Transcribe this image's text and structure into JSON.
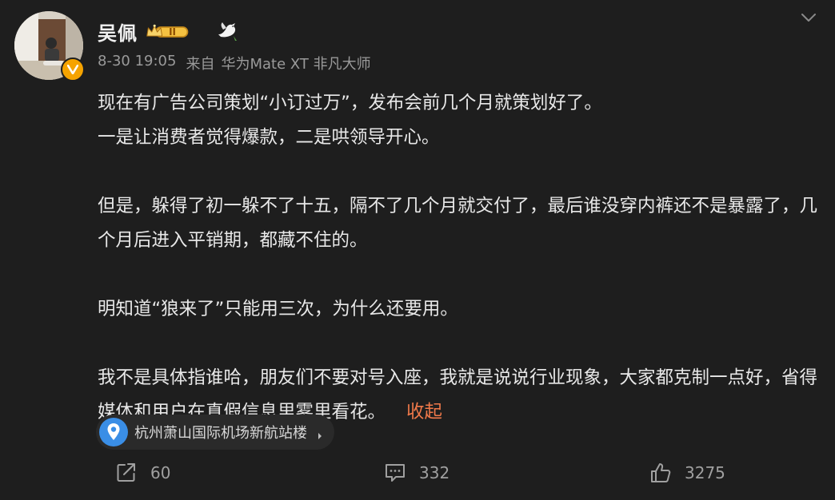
{
  "user": {
    "name": "吴佩",
    "vip_level": "II"
  },
  "meta": {
    "time": "8-30 19:05",
    "source_prefix": "来自",
    "device": "华为Mate XT 非凡大师"
  },
  "content": {
    "paragraphs": [
      [
        "现在有广告公司策划“小订过万”，发布会前几个月就策划好了。",
        "一是让消费者觉得爆款，二是哄领导开心。"
      ],
      [
        "但是，躲得了初一躲不了十五，隔不了几个月就交付了，最后谁没穿内裤还不是暴露了，几个月后进入平销期，都藏不住的。"
      ],
      [
        "明知道“狼来了”只能用三次，为什么还要用。"
      ],
      [
        "我不是具体指谁哈，朋友们不要对号入座，我就是说说行业现象，大家都克制一点好，省得媒体和用户在真假信息里雾里看花。"
      ]
    ],
    "collapse_label": "收起"
  },
  "location": {
    "label": "杭州萧山国际机场新航站楼"
  },
  "actions": {
    "repost_count": "60",
    "comment_count": "332",
    "like_count": "3275"
  },
  "colors": {
    "background": "#1e1e1e",
    "text": "#e8e8e8",
    "meta": "#9a9a9a",
    "accent": "#f0794a",
    "verified": "#f5a300",
    "location_pin": "#3a8ee6"
  },
  "icons": {
    "menu": "chevron-down-icon",
    "verified": "verified-v-icon",
    "vip": "crown-vip-badge-icon",
    "dove": "dove-icon",
    "location": "location-pin-icon",
    "repost": "repost-icon",
    "comment": "comment-icon",
    "like": "thumbs-up-icon"
  }
}
